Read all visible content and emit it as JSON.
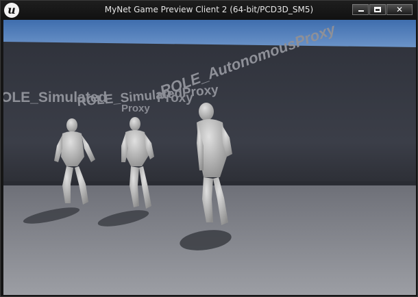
{
  "window": {
    "title": "MyNet Game Preview Client 2 (64-bit/PCD3D_SM5)",
    "logo_letter": "u",
    "controls": {
      "minimize": "minimize",
      "maximize": "maximize",
      "close": "✕"
    }
  },
  "scene": {
    "labels": {
      "left": "OLE_Simulated",
      "middle": "ROLE_SimulatedProxy",
      "right": "ROLE_AutonomousProxy",
      "proxy_a": "Proxy",
      "proxy_b": "Proxy"
    },
    "colors": {
      "sky": "#4f79b6",
      "wall": "#373a44",
      "floor": "#8d8f96",
      "mannequin": "#c6c6c6"
    }
  }
}
